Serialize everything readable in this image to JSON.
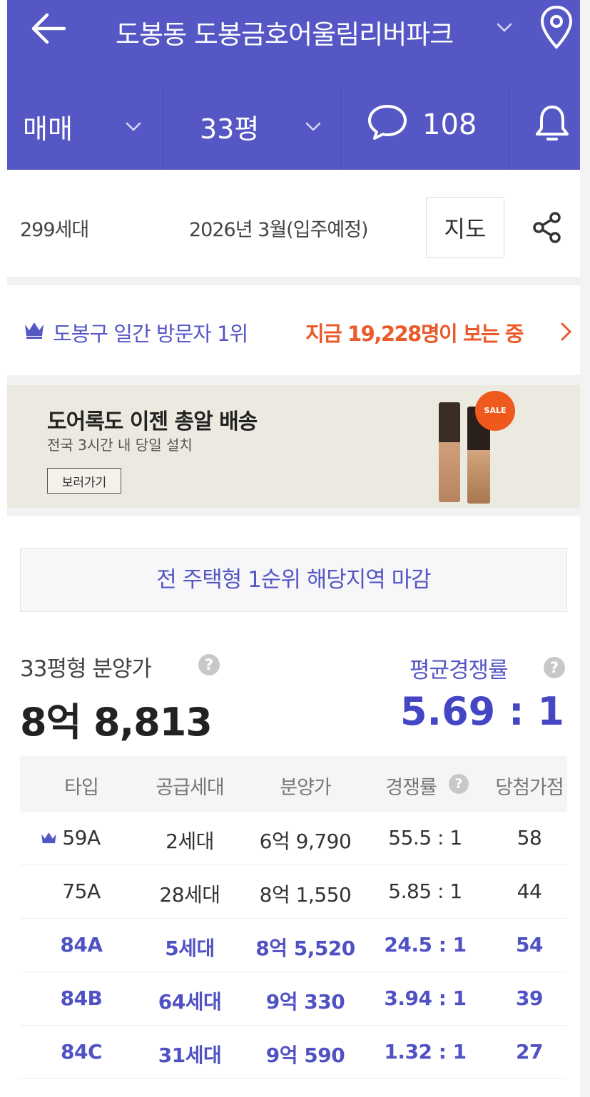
{
  "header": {
    "title": "도봉동 도봉금호어울림리버파크",
    "deal_type": "매매",
    "size": "33평",
    "comment_count": "108",
    "accent_color": "#5557c4",
    "icons": [
      "back-arrow-icon",
      "chevron-down-icon",
      "location-pin-icon",
      "chat-bubble-icon",
      "bell-icon"
    ]
  },
  "info": {
    "households": "299세대",
    "move_in": "2026년 3월(입주예정)",
    "map_button": "지도",
    "share_icon": "share-icon"
  },
  "ranking": {
    "icon": "crown-icon",
    "text": "도봉구 일간 방문자 1위",
    "visitors_text": "지금 19,228명이 보는 중",
    "visitors_color": "#ea5a2a"
  },
  "ad": {
    "title": "도어록도 이젠 총알 배송",
    "subtitle": "전국 3시간 내 당일 설치",
    "button": "보러가기",
    "badge": "SALE"
  },
  "closed_notice": "전 주택형 1순위 해당지역 마감",
  "price": {
    "label": "33평형 분양가",
    "value": "8억 8,813",
    "help_icon": "?"
  },
  "competition": {
    "label": "평균경쟁률",
    "value": "5.69 : 1",
    "help_icon": "?"
  },
  "table": {
    "headers": [
      "타입",
      "공급세대",
      "분양가",
      "경쟁률",
      "당첨가점"
    ],
    "rows": [
      {
        "type": "59A",
        "supply": "2세대",
        "price": "6억 9,790",
        "ratio": "55.5 : 1",
        "score": "58"
      },
      {
        "type": "75A",
        "supply": "28세대",
        "price": "8억 1,550",
        "ratio": "5.85 : 1",
        "score": "44"
      },
      {
        "type": "84A",
        "supply": "5세대",
        "price": "8억 5,520",
        "ratio": "24.5 : 1",
        "score": "54"
      },
      {
        "type": "84B",
        "supply": "64세대",
        "price": "9억 330",
        "ratio": "3.94 : 1",
        "score": "39"
      },
      {
        "type": "84C",
        "supply": "31세대",
        "price": "9억 590",
        "ratio": "1.32 : 1",
        "score": "27"
      }
    ]
  }
}
